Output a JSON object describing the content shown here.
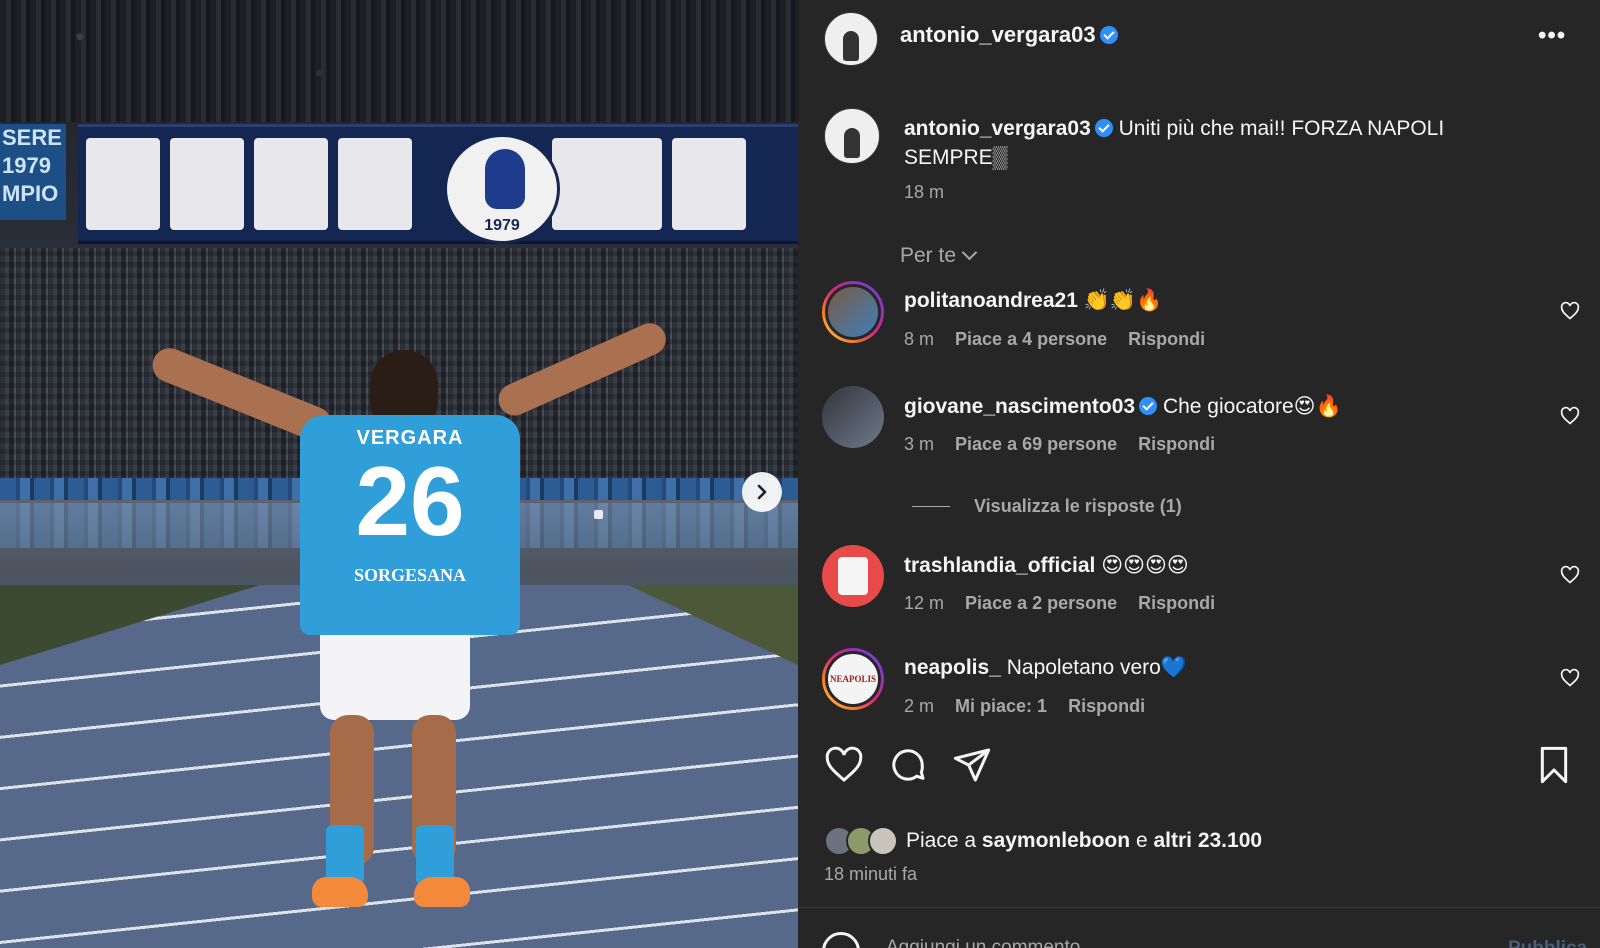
{
  "post": {
    "username": "antonio_vergara03",
    "verified": true,
    "more_label": "•••"
  },
  "media": {
    "banner_side_text": "SERE 1979 MPIO",
    "crest_year": "1979",
    "jersey_name": "VERGARA",
    "jersey_number": "26",
    "jersey_sponsor": "SORGESANA",
    "next_icon": "chevron-right-icon",
    "carousel_dots": 1
  },
  "caption": {
    "username": "antonio_vergara03",
    "text": "Uniti più che mai!! FORZA NAPOLI SEMPRE▒",
    "time": "18 m"
  },
  "filter": {
    "label": "Per te"
  },
  "comments": [
    {
      "username": "politanoandrea21",
      "verified": false,
      "text": "👏👏🔥",
      "time": "8 m",
      "likes": "Piace a 4 persone",
      "reply": "Rispondi"
    },
    {
      "username": "giovane_nascimento03",
      "verified": true,
      "text": "Che giocatore😍🔥",
      "time": "3 m",
      "likes": "Piace a 69 persone",
      "reply": "Rispondi",
      "view_replies": "Visualizza le risposte (1)"
    },
    {
      "username": "trashlandia_official",
      "verified": false,
      "text": "😍😍😍😍",
      "time": "12 m",
      "likes": "Piace a 2 persone",
      "reply": "Rispondi"
    },
    {
      "username": "neapolis_",
      "verified": false,
      "text": "Napoletano vero💙",
      "time": "2 m",
      "likes": "Mi piace: 1",
      "reply": "Rispondi",
      "avatar_text": "NEAPOLIS"
    }
  ],
  "actions": {
    "like_icon": "heart-icon",
    "comment_icon": "comment-bubble-icon",
    "share_icon": "send-icon",
    "save_icon": "bookmark-icon"
  },
  "likes": {
    "prefix": "Piace a",
    "user": "saymonleboon",
    "conj": "e",
    "others": "altri 23.100"
  },
  "time_ago": "18 minuti fa",
  "comment_box": {
    "placeholder": "Aggiungi un commento...",
    "publish_label": "Pubblica"
  },
  "colors": {
    "panel_bg": "#262626",
    "text_primary": "#f5f5f5",
    "text_secondary": "#a8a8a8",
    "verified_blue": "#2f8ffb",
    "publish_disabled": "#4a5d7a"
  }
}
